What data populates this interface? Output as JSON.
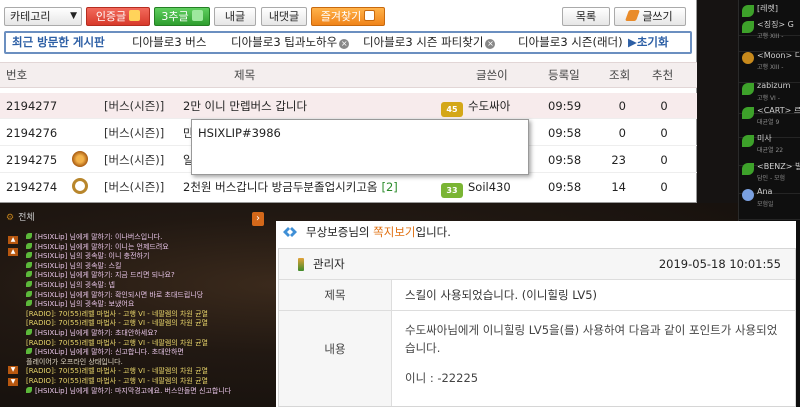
{
  "toolbar": {
    "category_select": "카테고리",
    "certified_btn": "인증글",
    "like3_btn": "3추글",
    "mypost_btn": "내글",
    "mycomment_btn": "내댓글",
    "favorites_btn": "즐겨찾기",
    "list_btn": "목록",
    "write_btn": "글쓰기"
  },
  "recent": {
    "title": "최근 방문한 게시판",
    "items": [
      "디아블로3 버스",
      "디아블로3 팁과노하우",
      "디아블로3 시즌 파티찾기",
      "디아블로3 시즌(래더)"
    ],
    "reset": "▶초기화"
  },
  "table": {
    "headers": {
      "num": "번호",
      "title": "제목",
      "author": "글쓴이",
      "date": "등록일",
      "views": "조회",
      "likes": "추천"
    },
    "rows": [
      {
        "num": "2194277",
        "cat": "[버스(시즌)]",
        "title": "2만 이니 만렙버스 갑니다",
        "comments": "",
        "level": "45",
        "author": "수도싸아",
        "date": "09:59",
        "views": "0",
        "likes": "0"
      },
      {
        "num": "2194276",
        "cat": "[버스(시즌)]",
        "title": "만",
        "comments": "",
        "level": "",
        "author": "",
        "date": "09:58",
        "views": "0",
        "likes": "0"
      },
      {
        "num": "2194275",
        "cat": "[버스(시즌)]",
        "title": "일",
        "comments": "",
        "level": "",
        "author": "",
        "date": "09:58",
        "views": "23",
        "likes": "0"
      },
      {
        "num": "2194274",
        "cat": "[버스(시즌)]",
        "title": "2천원 버스갑니다 방금두분졸업시키고옴",
        "comments": "[2]",
        "level": "33",
        "author": "Soil430",
        "date": "09:58",
        "views": "14",
        "likes": "0"
      }
    ]
  },
  "tooltip": {
    "text": "HSIXLIP#3986"
  },
  "chat": {
    "header": "전체",
    "lines": [
      "[HSIXLip] 님에게 말하기: 이나버스입니다.",
      "[HSIXLip] 님에게 말하기: 이니는 언제드려요",
      "[HSIXLip] 님의 귓속말: 이니 충전하기",
      "[HSIXLip] 님의 귓속말: 스킬",
      "[HSIXLip] 님에게 말하기: 지금 드리면 되나요?",
      "[HSIXLip] 님의 귓속말: 넵",
      "[HSIXLip] 님에게 말하기: 확인되시면 바로 초대드립니당",
      "[HSIXLip] 님의 귓속말: 보냈어요",
      "[RADIO]: 70(55)레벨 마법사 - 고행 VI - 네팔렘의 차원 균열",
      "[RADIO]: 70(55)레벨 마법사 - 고행 VI - 네팔렘의 차원 균열",
      "[HSIXLip] 님에게 말하기: 초대안하세요?",
      "[RADIO]: 70(55)레벨 마법사 - 고행 VI - 네팔렘의 차원 균열",
      "[HSIXLip] 님에게 말하기: 신고합니다. 초대안하면",
      "플레이어가 오프라인 상태입니다.",
      "[RADIO]: 70(55)레벨 마법사 - 고행 VI - 네팔렘의 차원 균열",
      "[RADIO]: 70(55)레벨 마법사 - 고행 VI - 네팔렘의 차원 균열",
      "[HSIXLip] 님에게 말하기: 마지막경고에요. 버스안돌면 신고합니다"
    ]
  },
  "rightcol": {
    "users": [
      {
        "name": "[레렛]",
        "sub": ""
      },
      {
        "name": "<징징> G",
        "sub": "고행 XIII -"
      },
      {
        "name": "<Moon> 디",
        "sub": "고행 XIII -"
      },
      {
        "name": "zabizum",
        "sub": "고행 VI -"
      },
      {
        "name": "<CART> 르",
        "sub": "대균열 9"
      },
      {
        "name": "미사",
        "sub": "대균열 22"
      },
      {
        "name": "<BENZ> 빌",
        "sub": "담인 - 모험"
      },
      {
        "name": "Ana",
        "sub": "모험일"
      }
    ]
  },
  "message": {
    "sender": "무상보증",
    "suffix": "님의 ",
    "highlight": "쪽지보기",
    "end": "입니다.",
    "from_name": "관리자",
    "sent_date": "2019-05-18 10:01:55",
    "subject_label": "제목",
    "subject_value": "스킬이 사용되었습니다. (이니힐링 LV5)",
    "content_label": "내용",
    "content_line1": "수도싸아님에게 이니힐링 LV5을(를) 사용하여 다음과 같이 포인트가 사용되었습니다.",
    "content_line2": "이니 : -22225"
  },
  "colors": {
    "accent_blue": "#2d5fa5",
    "highlight_orange": "#e07012",
    "row_highlight": "#f7ebec"
  }
}
